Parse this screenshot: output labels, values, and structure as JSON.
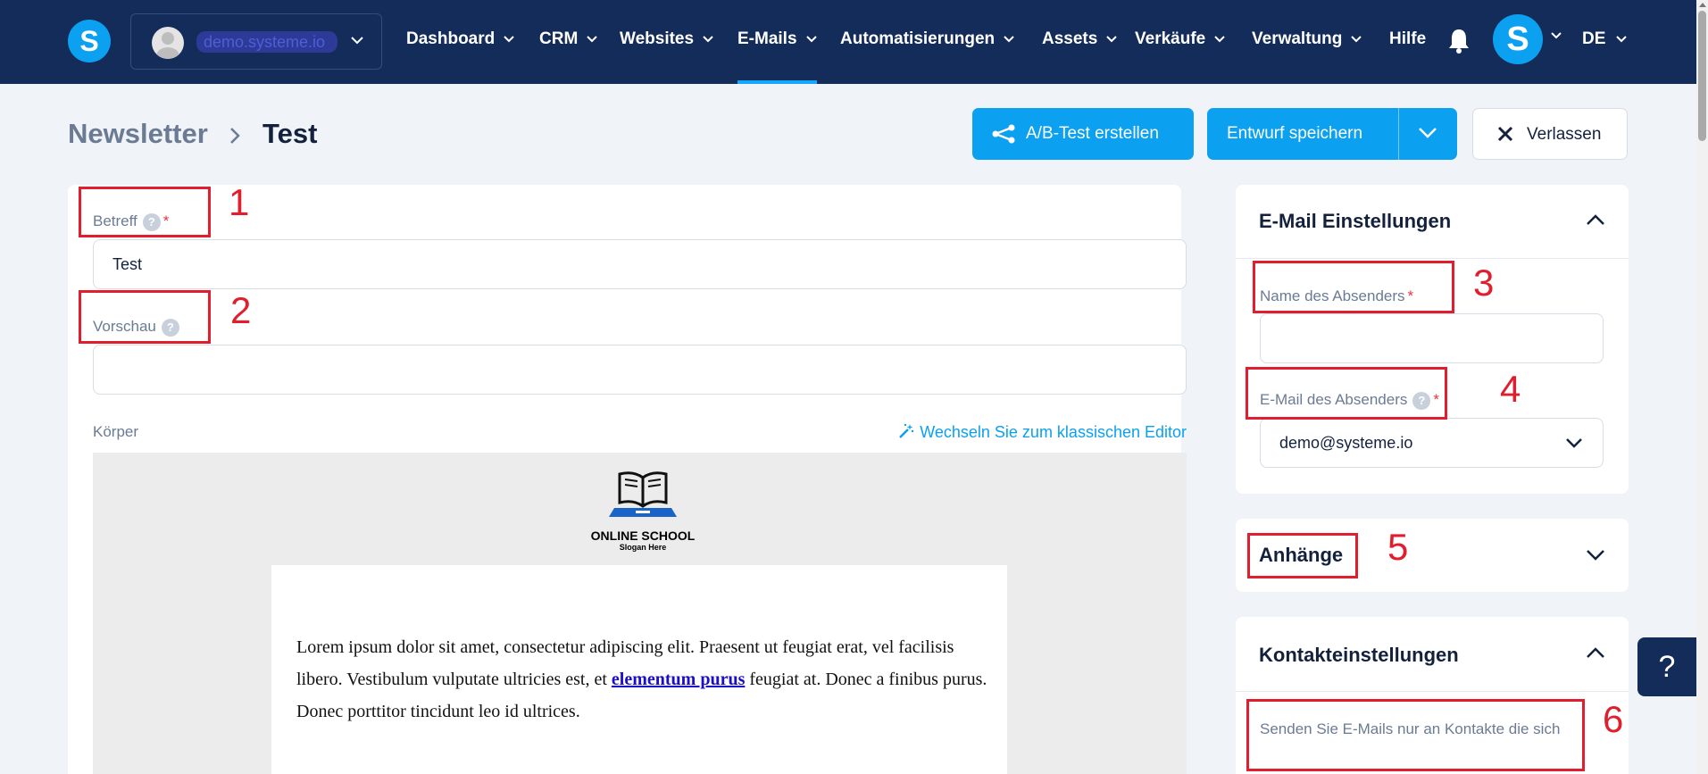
{
  "account": {
    "name": "demo.systeme.io"
  },
  "logo": {
    "letter": "S"
  },
  "nav": [
    {
      "label": "Dashboard",
      "has_menu": true
    },
    {
      "label": "CRM",
      "has_menu": true
    },
    {
      "label": "Websites",
      "has_menu": true
    },
    {
      "label": "E-Mails",
      "has_menu": true,
      "active": true
    },
    {
      "label": "Automatisierungen",
      "has_menu": true
    },
    {
      "label": "Assets",
      "has_menu": true
    },
    {
      "label": "Verkäufe",
      "has_menu": true
    },
    {
      "label": "Verwaltung",
      "has_menu": true
    },
    {
      "label": "Hilfe",
      "has_menu": false
    }
  ],
  "user": {
    "initial": "S"
  },
  "language": "DE",
  "breadcrumb": {
    "parent": "Newsletter",
    "current": "Test"
  },
  "actions": {
    "ab_test": "A/B-Test erstellen",
    "save_draft": "Entwurf speichern",
    "leave": "Verlassen"
  },
  "form": {
    "subject": {
      "label": "Betreff",
      "value": "Test",
      "required": true
    },
    "preview": {
      "label": "Vorschau",
      "value": ""
    },
    "body": {
      "label": "Körper",
      "switch_editor": "Wechseln Sie zum klassischen Editor",
      "logo_title": "ONLINE SCHOOL",
      "logo_slogan": "Slogan Here",
      "text_before": "Lorem ipsum dolor sit amet, consectetur adipiscing elit. Praesent ut feugiat erat, vel facilisis libero. Vestibulum vulputate ultricies est, et ",
      "link_text": "elementum purus",
      "text_after": " feugiat at. Donec a finibus purus. Donec porttitor tincidunt leo id ultrices."
    }
  },
  "email_settings": {
    "title": "E-Mail Einstellungen",
    "sender_name": {
      "label": "Name des Absenders",
      "value": "",
      "required": true
    },
    "sender_email": {
      "label": "E-Mail des Absenders",
      "value": "demo@systeme.io",
      "required": true
    }
  },
  "attachments": {
    "title": "Anhänge"
  },
  "contact_settings": {
    "title": "Kontakteinstellungen",
    "only_send_label": "Senden Sie E-Mails nur an Kontakte die sich"
  },
  "annotations": [
    "1",
    "2",
    "3",
    "4",
    "5",
    "6"
  ],
  "help_fab": "?",
  "colors": {
    "nav_bg": "#142c5a",
    "accent": "#0ca0f0",
    "annotation": "#e01e2e"
  }
}
